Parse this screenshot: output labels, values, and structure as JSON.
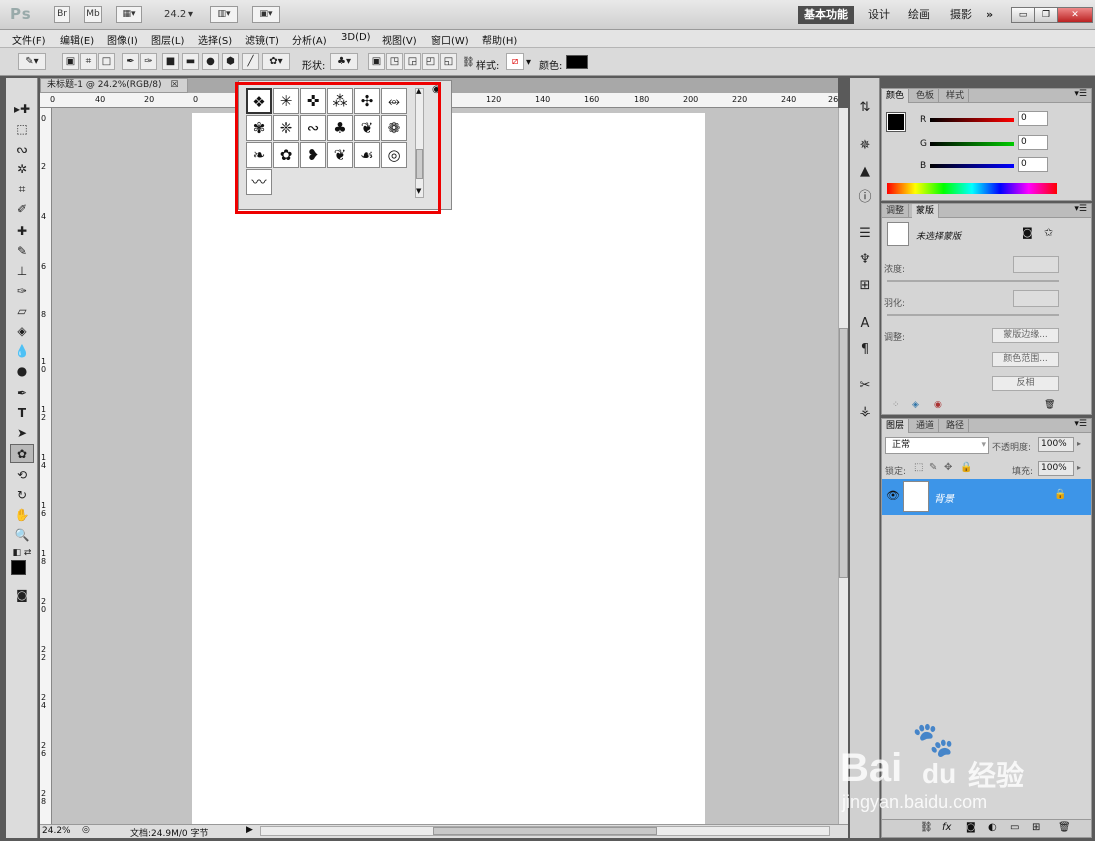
{
  "titlebar": {
    "app_logo": "Ps",
    "br": "Br",
    "mb": "Mb",
    "zoom": "24.2",
    "workspaces": [
      "基本功能",
      "设计",
      "绘画",
      "摄影"
    ],
    "more": "»"
  },
  "menu": [
    "文件(F)",
    "编辑(E)",
    "图像(I)",
    "图层(L)",
    "选择(S)",
    "滤镜(T)",
    "分析(A)",
    "3D(D)",
    "视图(V)",
    "窗口(W)",
    "帮助(H)"
  ],
  "options": {
    "shape_label": "形状:",
    "style_label": "样式:",
    "color_label": "颜色:",
    "color_value": "#000000"
  },
  "document": {
    "tab_title": "未标题-1 @ 24.2%(RGB/8)",
    "tab_close": "☒",
    "ruler_h": [
      "0",
      "40",
      "20",
      "0",
      "120",
      "140",
      "160",
      "180",
      "200",
      "220",
      "240",
      "26"
    ],
    "ruler_v": [
      "0",
      "2",
      "4",
      "6",
      "8",
      "1\n0",
      "1\n2",
      "1\n4",
      "1\n6",
      "1\n8",
      "2\n0",
      "2\n2",
      "2\n4",
      "2\n6",
      "2\n8"
    ],
    "status_zoom": "24.2%",
    "status_doc": "文档:24.9M/0 字节"
  },
  "picker": {
    "shapes": [
      "❖",
      "✳",
      "✜",
      "⁂",
      "✣",
      "⥈",
      "✾",
      "❈",
      "∾",
      "♣",
      "❦",
      "❁",
      "❧",
      "✿",
      "❥",
      "❦",
      "☙",
      "◎",
      "〰"
    ]
  },
  "color_panel": {
    "tabs": [
      "颜色",
      "色板",
      "样式"
    ],
    "r_label": "R",
    "g_label": "G",
    "b_label": "B",
    "r": "0",
    "g": "0",
    "b": "0"
  },
  "mask_panel": {
    "tabs": [
      "调整",
      "蒙版"
    ],
    "no_mask": "未选择蒙版",
    "density": "浓度:",
    "feather": "羽化:",
    "refine": "调整:",
    "mask_edge": "蒙版边缘...",
    "color_range": "颜色范围...",
    "invert": "反相"
  },
  "layers_panel": {
    "tabs": [
      "图层",
      "通道",
      "路径"
    ],
    "blend_mode": "正常",
    "opacity_label": "不透明度:",
    "opacity": "100%",
    "lock_label": "锁定:",
    "fill_label": "填充:",
    "fill": "100%",
    "layer_name": "背景"
  },
  "watermark": {
    "brand": "Bai",
    "brand2": "du",
    "cn": "经验",
    "url": "jingyan.baidu.com"
  }
}
